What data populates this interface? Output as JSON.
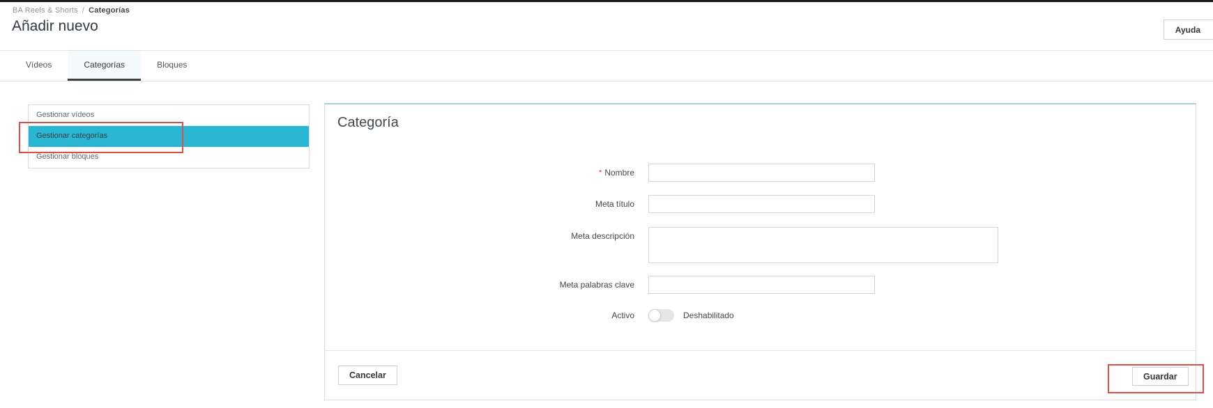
{
  "colors": {
    "accent_cyan": "#29b6d2",
    "annotation_red": "#dd4f44",
    "panel_top_border": "#a9cbdc",
    "tab_active_underline": "#3c4145",
    "required_asterisk": "#e02b27"
  },
  "header": {
    "breadcrumb": {
      "root": "BA Reels & Shorts",
      "separator": "/",
      "current": "Categorías"
    },
    "title": "Añadir nuevo",
    "help_button_label": "Ayuda"
  },
  "tabs": {
    "items": [
      {
        "label": "Vídeos",
        "active": false
      },
      {
        "label": "Categorías",
        "active": true
      },
      {
        "label": "Bloques",
        "active": false
      }
    ]
  },
  "sidebar": {
    "items": [
      {
        "label": "Gestionar vídeos",
        "active": false
      },
      {
        "label": "Gestionar categorías",
        "active": true
      },
      {
        "label": "Gestionar bloques",
        "active": false
      }
    ]
  },
  "form": {
    "heading": "Categoría",
    "required_marker": "*",
    "fields": [
      {
        "label": "Nombre",
        "required": true,
        "type": "text",
        "value": ""
      },
      {
        "label": "Meta título",
        "required": false,
        "type": "text",
        "value": ""
      },
      {
        "label": "Meta descripción",
        "required": false,
        "type": "textarea",
        "value": ""
      },
      {
        "label": "Meta palabras clave",
        "required": false,
        "type": "text",
        "value": ""
      },
      {
        "label": "Activo",
        "required": false,
        "type": "toggle",
        "state": "off",
        "state_label": "Deshabilitado"
      }
    ]
  },
  "footer": {
    "cancel_label": "Cancelar",
    "save_label": "Guardar"
  }
}
